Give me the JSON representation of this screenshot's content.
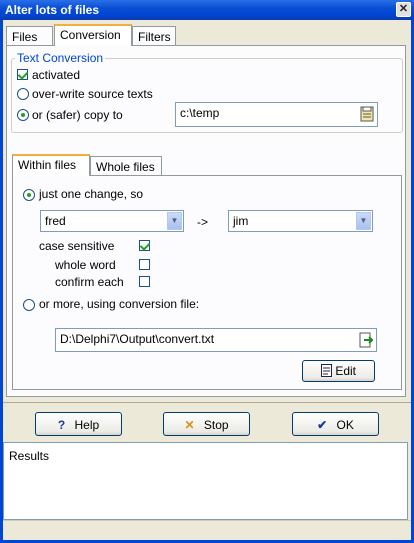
{
  "window": {
    "title": "Alter lots of files",
    "close_glyph": "✕"
  },
  "tabs": [
    {
      "label": "Files"
    },
    {
      "label": "Conversion"
    },
    {
      "label": "Filters"
    }
  ],
  "text_conversion": {
    "group_label": "Text Conversion",
    "activated_label": "activated",
    "overwrite_label": "over-write source texts",
    "copy_label": "or (safer) copy to",
    "copy_path": "c:\\temp"
  },
  "inner_tabs": [
    {
      "label": "Within files"
    },
    {
      "label": "Whole files"
    }
  ],
  "within": {
    "one_change_label": "just one change, so",
    "from_value": "fred",
    "arrow": "->",
    "to_value": "jim",
    "case_sensitive_label": "case sensitive",
    "whole_word_label": "whole word",
    "confirm_each_label": "confirm each",
    "more_label": "or more, using conversion file:",
    "conversion_file": "D:\\Delphi7\\Output\\convert.txt",
    "edit_label": "Edit"
  },
  "buttons": {
    "help_label": "Help",
    "help_glyph": "?",
    "stop_label": "Stop",
    "stop_glyph": "✕",
    "ok_label": "OK",
    "ok_glyph": "✔"
  },
  "results": {
    "label": "Results"
  },
  "colors": {
    "title_bar": "#0046d5",
    "accent": "#21a121",
    "group_label": "#0046d5"
  }
}
